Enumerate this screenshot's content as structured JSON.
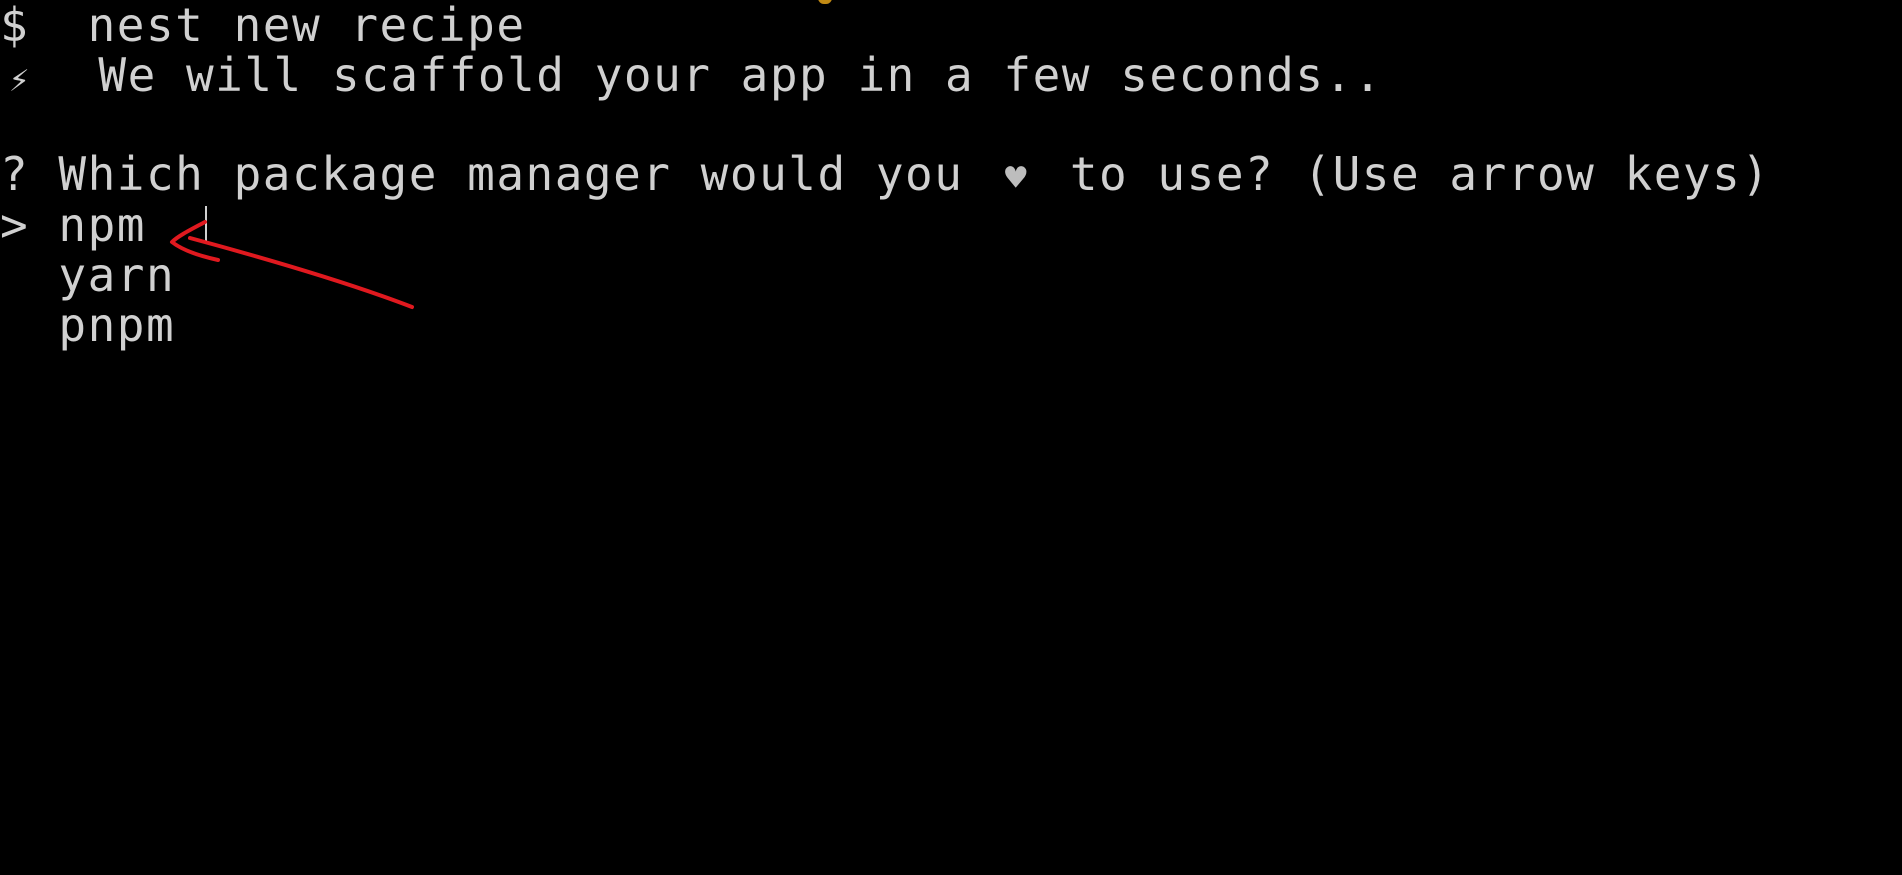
{
  "terminal": {
    "prompt_symbol": "$",
    "command": "nest new recipe",
    "info_icon": "lightning-bolt-icon",
    "info_text": "We will scaffold your app in a few seconds..",
    "question": {
      "mark": "?",
      "text_before": "Which package manager would you",
      "icon": "heart-icon",
      "text_after": "to use? (Use arrow keys)"
    },
    "selection_pointer": ">",
    "options": [
      "npm",
      "yarn",
      "pnpm"
    ],
    "selected_option": "npm"
  },
  "colors": {
    "background": "#000000",
    "text": "#d0d0d0",
    "annotation": "#e0191f",
    "accent": "#c28a14"
  }
}
